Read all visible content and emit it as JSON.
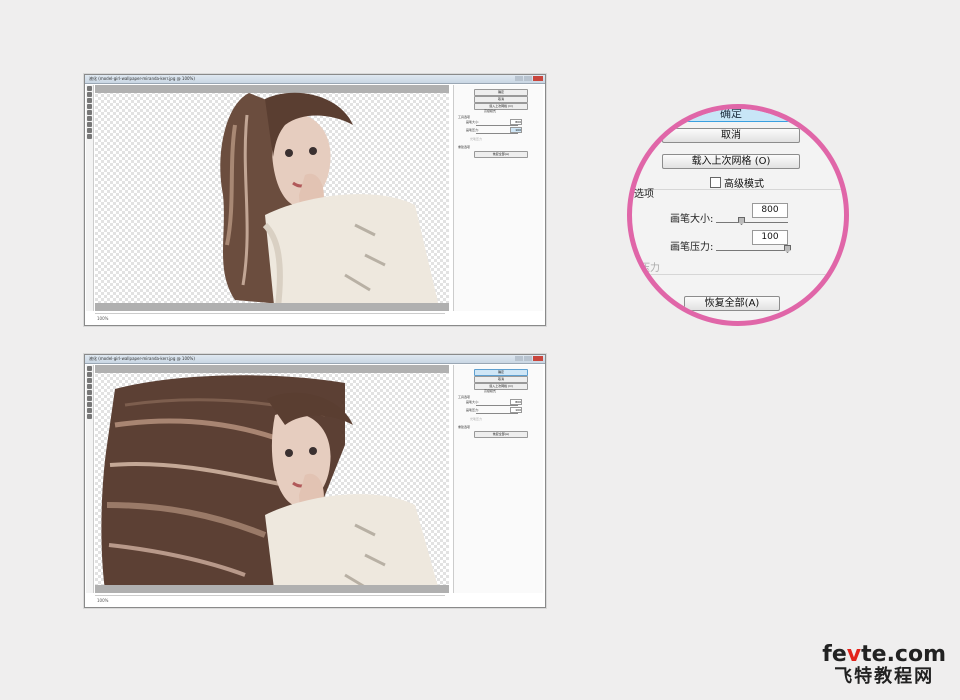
{
  "windows": [
    {
      "title": "液化 (model-girl-wallpaper-miranda-kerr.jpg @ 100%)",
      "status": "100%",
      "panel": {
        "ok": "确定",
        "cancel": "取消",
        "load_mesh": "载入上次网格 (O)",
        "advanced": "高级模式",
        "section": "工具选项",
        "brush_size_label": "画笔大小:",
        "brush_size": "800",
        "brush_pressure_label": "画笔压力:",
        "brush_pressure": "100",
        "pressure": "光笔压力",
        "rebuild_label": "重建选项",
        "restore": "恢复全部(A)"
      }
    },
    {
      "title": "液化 (model-girl-wallpaper-miranda-kerr.jpg @ 100%)",
      "status": "100%",
      "panel": {
        "ok": "确定",
        "cancel": "取消",
        "load_mesh": "载入上次网格 (O)",
        "advanced": "高级模式",
        "section": "工具选项",
        "brush_size_label": "画笔大小:",
        "brush_size": "800",
        "brush_pressure_label": "画笔压力:",
        "brush_pressure": "100",
        "pressure": "光笔压力",
        "rebuild_label": "重建选项",
        "restore": "恢复全部(A)"
      }
    }
  ],
  "magnifier": {
    "ok_partial": "确定",
    "cancel": "取消",
    "load_mesh": "载入上次网格 (O)",
    "advanced": "高级模式",
    "section_partial": "选项",
    "brush_size_label": "画笔大小:",
    "brush_size": "800",
    "brush_pressure_label": "画笔压力:",
    "brush_pressure": "100",
    "pressure_partial": "压力",
    "restore": "恢复全部(A)"
  },
  "watermark": {
    "brand_pre": "fe",
    "brand_accent": "v",
    "brand_post": "te.com",
    "cn": "飞特教程网"
  },
  "colors": {
    "magnifier_ring": "#e066a8",
    "ok_button": "#c8e6f7",
    "accent": "#e2231a"
  }
}
